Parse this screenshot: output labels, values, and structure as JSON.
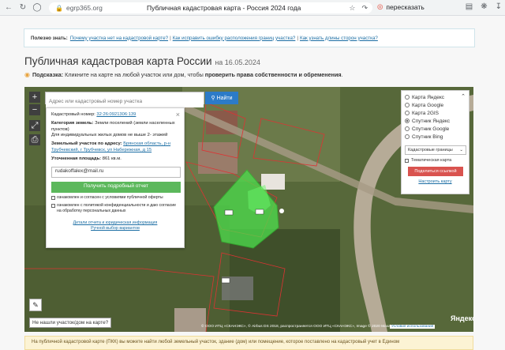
{
  "browser": {
    "domain": "egrp365.org",
    "tab_title": "Публичная кадастровая карта - Россия 2024 года",
    "translate_label": "пересказать"
  },
  "useful": {
    "label": "Полезно знать:",
    "links": [
      "Почему участка нет на кадастровой карте?",
      "Как исправить ошибку расположения границ участка?",
      "Как узнать длины сторон участка?"
    ],
    "separator": "|"
  },
  "header": {
    "title": "Публичная кадастровая карта России",
    "date": "на 16.05.2024"
  },
  "hint": {
    "prefix": "Подсказка:",
    "text": "Кликните на карте на любой участок или дом, чтобы",
    "bold": "проверить права собственности и обременения",
    "end": "."
  },
  "map": {
    "zoom_in": "+",
    "zoom_out": "−",
    "search_placeholder": "Адрес или кадастровый номер участка",
    "find_button": "Найти",
    "not_found": "Не нашли участок/дом на карте?",
    "copyright": "© ООО ИТЦ «СКАНЭКС», © Airbus DS 2018, распространяется ООО ИТЦ «СКАНЭКС», Image © 2020 Maxar",
    "yandex": "Яндекс",
    "terms": "Условия использования"
  },
  "popup": {
    "cad_label": "Кадастровый номер:",
    "cad_value": "32:26:0921306:139",
    "category_label": "Категория земель:",
    "category_value": "Земли поселений (земли населенных пунктов)",
    "purpose": "Для индивидуальных жилых домов не выше 2- этажей",
    "address_label": "Земельный участок по адресу:",
    "address_value": "Брянская область, р-н Трубчевский, г Трубчевск, ул Набережная, д 15",
    "area_label": "Уточненная площадь:",
    "area_value": "861 кв.м.",
    "email": "rudakoffalex@mail.ru",
    "get_report": "Получить подробный отчет",
    "agree1": "ознакомлен и согласен с условиями публичной оферты",
    "agree2": "ознакомлен с политикой конфиденциальности и даю согласие на обработку персональных данных",
    "report_details": "Детали отчета и юридическая информация",
    "manual": "Ручной выбор вариантов"
  },
  "layers": {
    "options": [
      "Карта Яндекс",
      "Карта Google",
      "Карта 2GIS",
      "Спутник Яндекс",
      "Спутник Google",
      "Спутник Bing"
    ],
    "selected_index": 3,
    "cad_borders": "Кадастровые границы",
    "thematic": "Тематическая карта",
    "share": "Поделиться ссылкой",
    "setup": "Настроить карту"
  },
  "bottom_note": "На публичной кадастровой карте (ПКК) вы можете найти любой земельный участок, здание (дом) или помещение, которое поставлено на кадастровый учет в Едином"
}
